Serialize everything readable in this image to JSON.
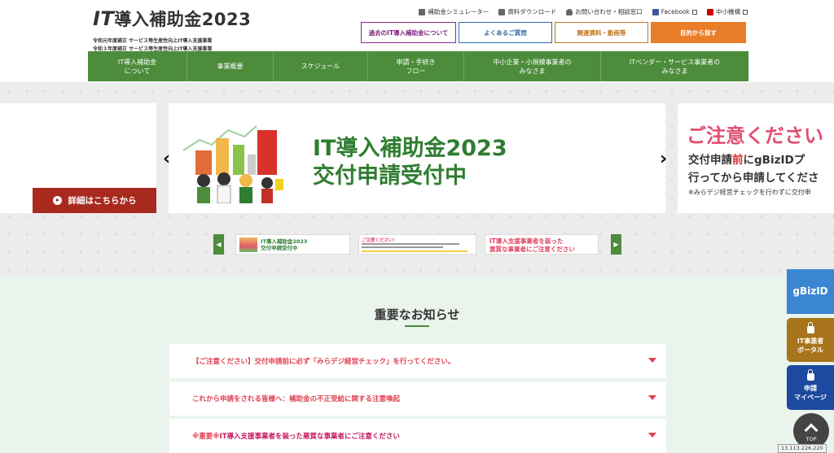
{
  "header": {
    "logo_prefix": "IT",
    "logo_rest": "導入補助金2023",
    "subtitle_1": "令和元年度補正 サービス等生産性向上IT導入支援事業",
    "subtitle_2": "令和３年度補正 サービス等生産性向上IT導入支援事業"
  },
  "toplinks": [
    {
      "label": "補助金シミュレーター",
      "icon": "calculator-icon"
    },
    {
      "label": "資料ダウンロード",
      "icon": "download-icon"
    },
    {
      "label": "お問い合わせ・相談窓口",
      "icon": "person-icon"
    },
    {
      "label": "Facebook",
      "icon": "facebook-icon"
    },
    {
      "label": "中小機構",
      "icon": "flag-icon"
    }
  ],
  "topbuttons": [
    "過去のIT導入補助金について",
    "よくあるご質問",
    "関連資料・動画等",
    "目的から探す"
  ],
  "nav": [
    "IT導入補助金\nについて",
    "事業概要",
    "スケジュール",
    "申請・手続き\nフロー",
    "中小企業・小規模事業者の\nみなさま",
    "ITベンダー・サービス事業者の\nみなさま"
  ],
  "hero": {
    "detail_button": "詳細はこちらから",
    "title_line1": "IT導入補助金2023",
    "title_line2": "交付申請受付中",
    "right_title": "ご注意ください",
    "right_line1_pre": "交付申請",
    "right_line1_red": "前",
    "right_line1_post": "にgBizIDプ",
    "right_line2": "行ってから申請してくださ",
    "right_line3": "※みらデジ経営チェックを行わずに交付申"
  },
  "thumbs": {
    "t1_line1": "IT導入補助金2023",
    "t1_line2": "交付申請受付中",
    "t2_title": "ご注意ください！",
    "t3_line1": "IT導入支援事業者を装った",
    "t3_line2": "悪質な事業者にご注意ください"
  },
  "news": {
    "title": "重要なお知らせ",
    "items": [
      {
        "prefix": "【ご注意ください】",
        "text": "交付申請前に必ず「みらデジ経営チェック」を行ってください。"
      },
      {
        "prefix": "",
        "text": "これから申請をされる皆様へ：補助金の不正受給に関する注意喚起"
      },
      {
        "prefix": "※重要※",
        "text": " IT導入支援事業者を装った悪質な事業者にご注意ください"
      }
    ]
  },
  "side": {
    "gbiz": "gBizID",
    "portal": "IT事業者\nポータル",
    "mypage": "申請\nマイページ",
    "top": "TOP"
  },
  "ip": "13.113.226.220",
  "colors": {
    "green": "#4c8c3a",
    "red_button": "#a8291d",
    "orange": "#e87d2a",
    "pink": "#e05070"
  }
}
